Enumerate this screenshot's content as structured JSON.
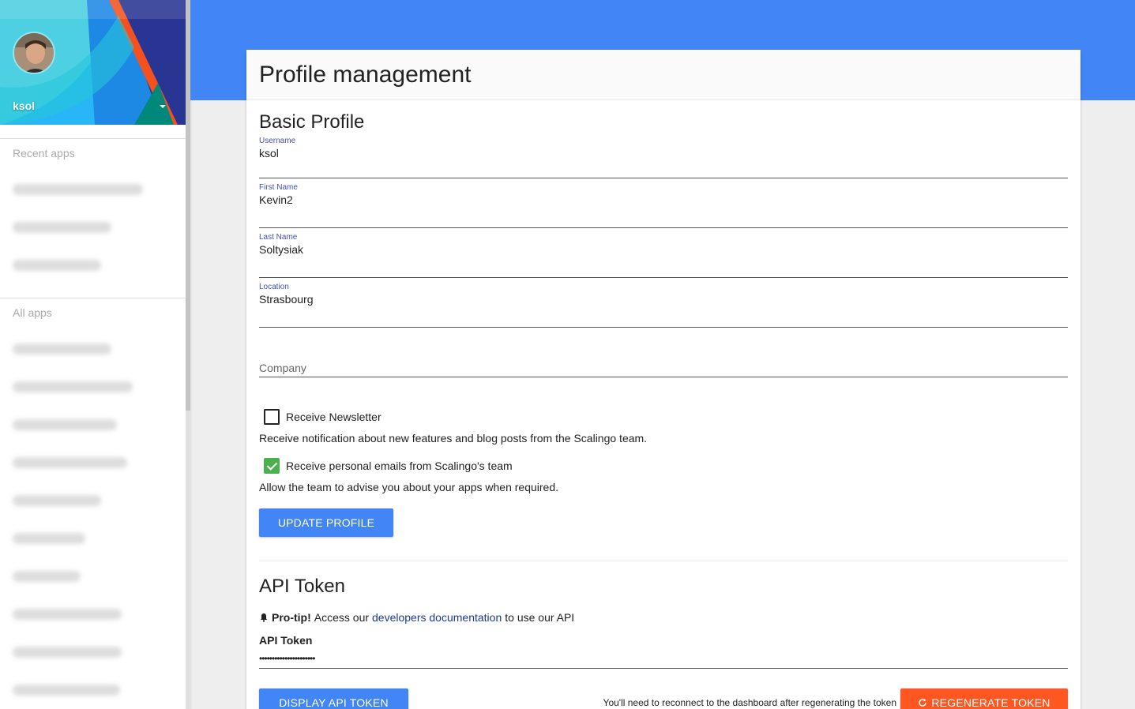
{
  "sidebar": {
    "username": "ksol",
    "recent_title": "Recent apps",
    "all_title": "All apps"
  },
  "page": {
    "title": "Profile management"
  },
  "basic_profile": {
    "title": "Basic Profile",
    "username": {
      "label": "Username",
      "value": "ksol"
    },
    "first_name": {
      "label": "First Name",
      "value": "Kevin2"
    },
    "last_name": {
      "label": "Last Name",
      "value": "Soltysiak"
    },
    "location": {
      "label": "Location",
      "value": "Strasbourg"
    },
    "company": {
      "placeholder": "Company",
      "value": ""
    },
    "newsletter": {
      "label": "Receive Newsletter",
      "checked": false,
      "help": "Receive notification about new features and blog posts from the Scalingo team."
    },
    "personal_emails": {
      "label": "Receive personal emails from Scalingo's team",
      "checked": true,
      "help": "Allow the team to advise you about your apps when required."
    },
    "update_button": "UPDATE PROFILE"
  },
  "api_token": {
    "title": "API Token",
    "protip_bold": "Pro-tip!",
    "protip_before": "Access our",
    "protip_link": "developers documentation",
    "protip_after": "to use our API",
    "field_label": "API Token",
    "masked_value": "••••••••••••••••••••••",
    "display_button": "DISPLAY API TOKEN",
    "regenerate_note": "You'll need to reconnect to the dashboard after regenerating the token",
    "regenerate_button": "REGENERATE TOKEN"
  },
  "colors": {
    "primary": "#4285f4",
    "danger": "#ff5722",
    "checked": "#4caf50"
  }
}
